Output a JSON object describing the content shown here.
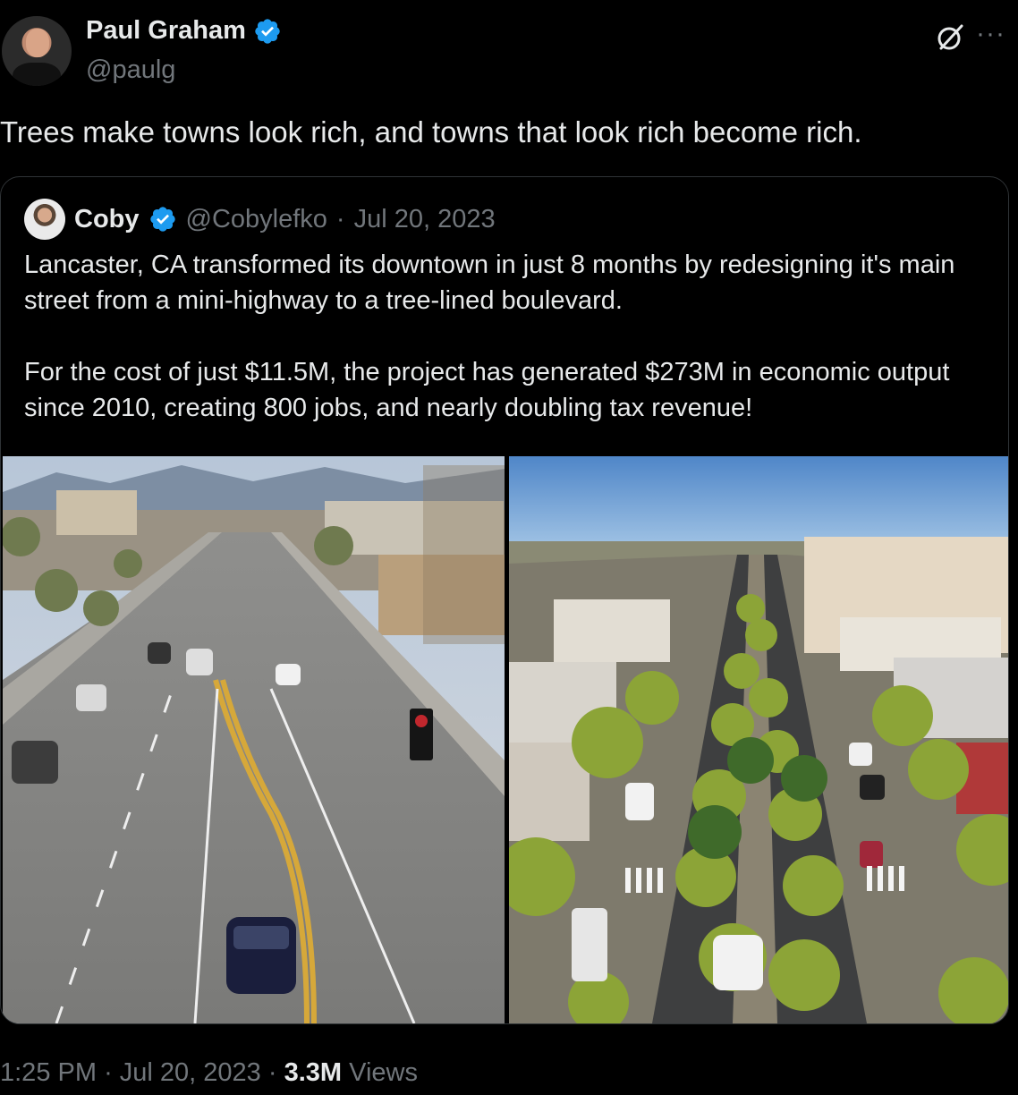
{
  "author": {
    "display_name": "Paul Graham",
    "handle": "@paulg",
    "verified": true
  },
  "tweet": {
    "text": "Trees make towns look rich, and towns that look rich become rich."
  },
  "quoted_tweet": {
    "display_name": "Coby",
    "handle": "@Cobylefko",
    "separator": "·",
    "date": "Jul 20, 2023",
    "verified": true,
    "paragraph_1": "Lancaster, CA transformed its downtown in just 8 months by redesigning it's main street from a mini-highway to a tree-lined boulevard.",
    "paragraph_2": "For the cost of just $11.5M, the project has generated $273M in economic output since 2010, creating 800 jobs, and nearly doubling tax revenue!",
    "images": [
      "before-street-photo",
      "after-boulevard-photo"
    ]
  },
  "footer": {
    "time": "1:25 PM",
    "sep1": "·",
    "date": "Jul 20, 2023",
    "sep2": "·",
    "views_count": "3.3M",
    "views_label": "Views"
  },
  "icons": {
    "verified": "verified-badge-icon",
    "grok": "grok-icon",
    "more": "more-icon"
  },
  "colors": {
    "background": "#000000",
    "text": "#e7e9ea",
    "muted": "#71767b",
    "verified": "#1d9bf0",
    "border": "#2f3336"
  }
}
